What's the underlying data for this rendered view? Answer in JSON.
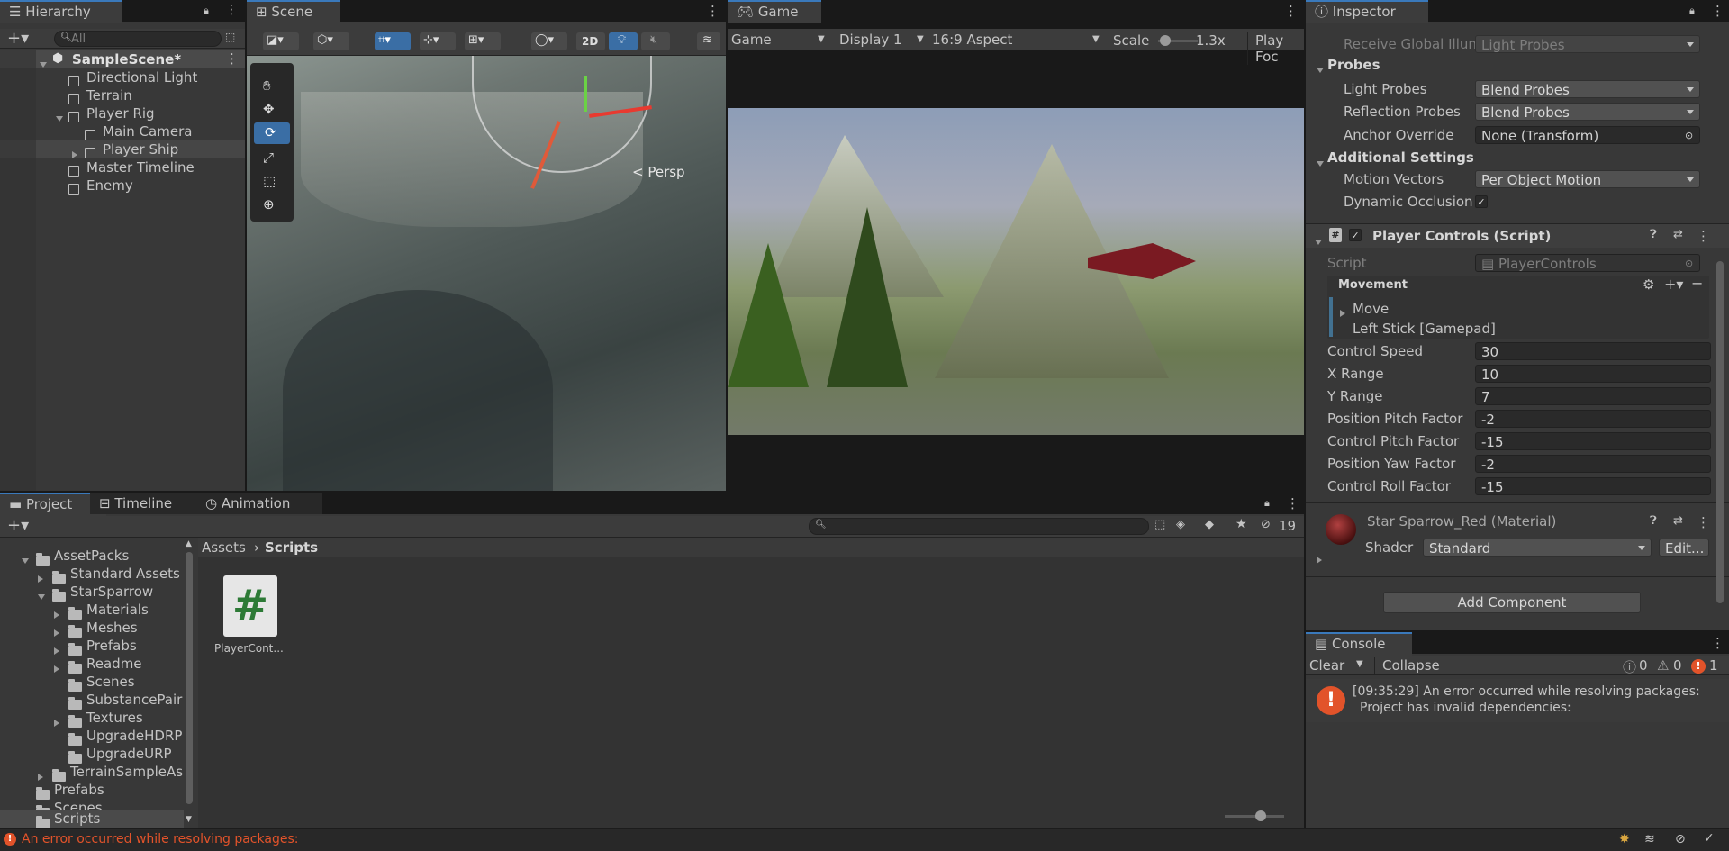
{
  "hierarchy": {
    "tab": "Hierarchy",
    "search_placeholder": "All",
    "scene": "SampleScene*",
    "items": [
      "Directional Light",
      "Terrain",
      "Player Rig",
      "Main Camera",
      "Player Ship",
      "Master Timeline",
      "Enemy"
    ]
  },
  "scene": {
    "tab": "Scene",
    "mode_2d": "2D",
    "persp": "< Persp"
  },
  "game": {
    "tab": "Game",
    "view": "Game",
    "display": "Display 1",
    "aspect": "16:9 Aspect",
    "scale_label": "Scale",
    "scale_value": "1.3x",
    "play_focus": "Play Foc"
  },
  "inspector": {
    "tab": "Inspector",
    "receive_gi_label": "Receive Global Illun",
    "receive_gi_value": "Light Probes",
    "probes_header": "Probes",
    "light_probes_label": "Light Probes",
    "light_probes_value": "Blend Probes",
    "reflection_probes_label": "Reflection Probes",
    "reflection_probes_value": "Blend Probes",
    "anchor_label": "Anchor Override",
    "anchor_value": "None (Transform)",
    "additional_header": "Additional Settings",
    "motion_label": "Motion Vectors",
    "motion_value": "Per Object Motion",
    "occlusion_label": "Dynamic Occlusion",
    "component_title": "Player Controls (Script)",
    "script_label": "Script",
    "script_value": "PlayerControls",
    "movement_label": "Movement",
    "move_label": "Move",
    "binding_label": "Left Stick [Gamepad]",
    "fields": [
      {
        "label": "Control Speed",
        "value": "30"
      },
      {
        "label": "X Range",
        "value": "10"
      },
      {
        "label": "Y Range",
        "value": "7"
      },
      {
        "label": "Position Pitch Factor",
        "value": "-2"
      },
      {
        "label": "Control Pitch Factor",
        "value": "-15"
      },
      {
        "label": "Position Yaw Factor",
        "value": "-2"
      },
      {
        "label": "Control Roll Factor",
        "value": "-15"
      }
    ],
    "material_title": "Star Sparrow_Red (Material)",
    "shader_label": "Shader",
    "shader_value": "Standard",
    "edit_label": "Edit...",
    "add_component": "Add Component"
  },
  "project": {
    "tabs": [
      "Project",
      "Timeline",
      "Animation"
    ],
    "tree": [
      "AssetPacks",
      "Standard Assets",
      "StarSparrow",
      "Materials",
      "Meshes",
      "Prefabs",
      "Readme",
      "Scenes",
      "SubstancePair",
      "Textures",
      "UpgradeHDRP",
      "UpgradeURP",
      "TerrainSampleAs",
      "Prefabs",
      "Scenes",
      "Scripts"
    ],
    "breadcrumb_root": "Assets",
    "breadcrumb_current": "Scripts",
    "hidden_count": "19",
    "asset_name": "PlayerCont..."
  },
  "console": {
    "tab": "Console",
    "clear": "Clear",
    "collapse": "Collapse",
    "info_count": "0",
    "warn_count": "0",
    "error_count": "1",
    "message_line1": "[09:35:29] An error occurred while resolving packages:",
    "message_line2": "Project has invalid dependencies:"
  },
  "status": {
    "message": "An error occurred while resolving packages:"
  }
}
